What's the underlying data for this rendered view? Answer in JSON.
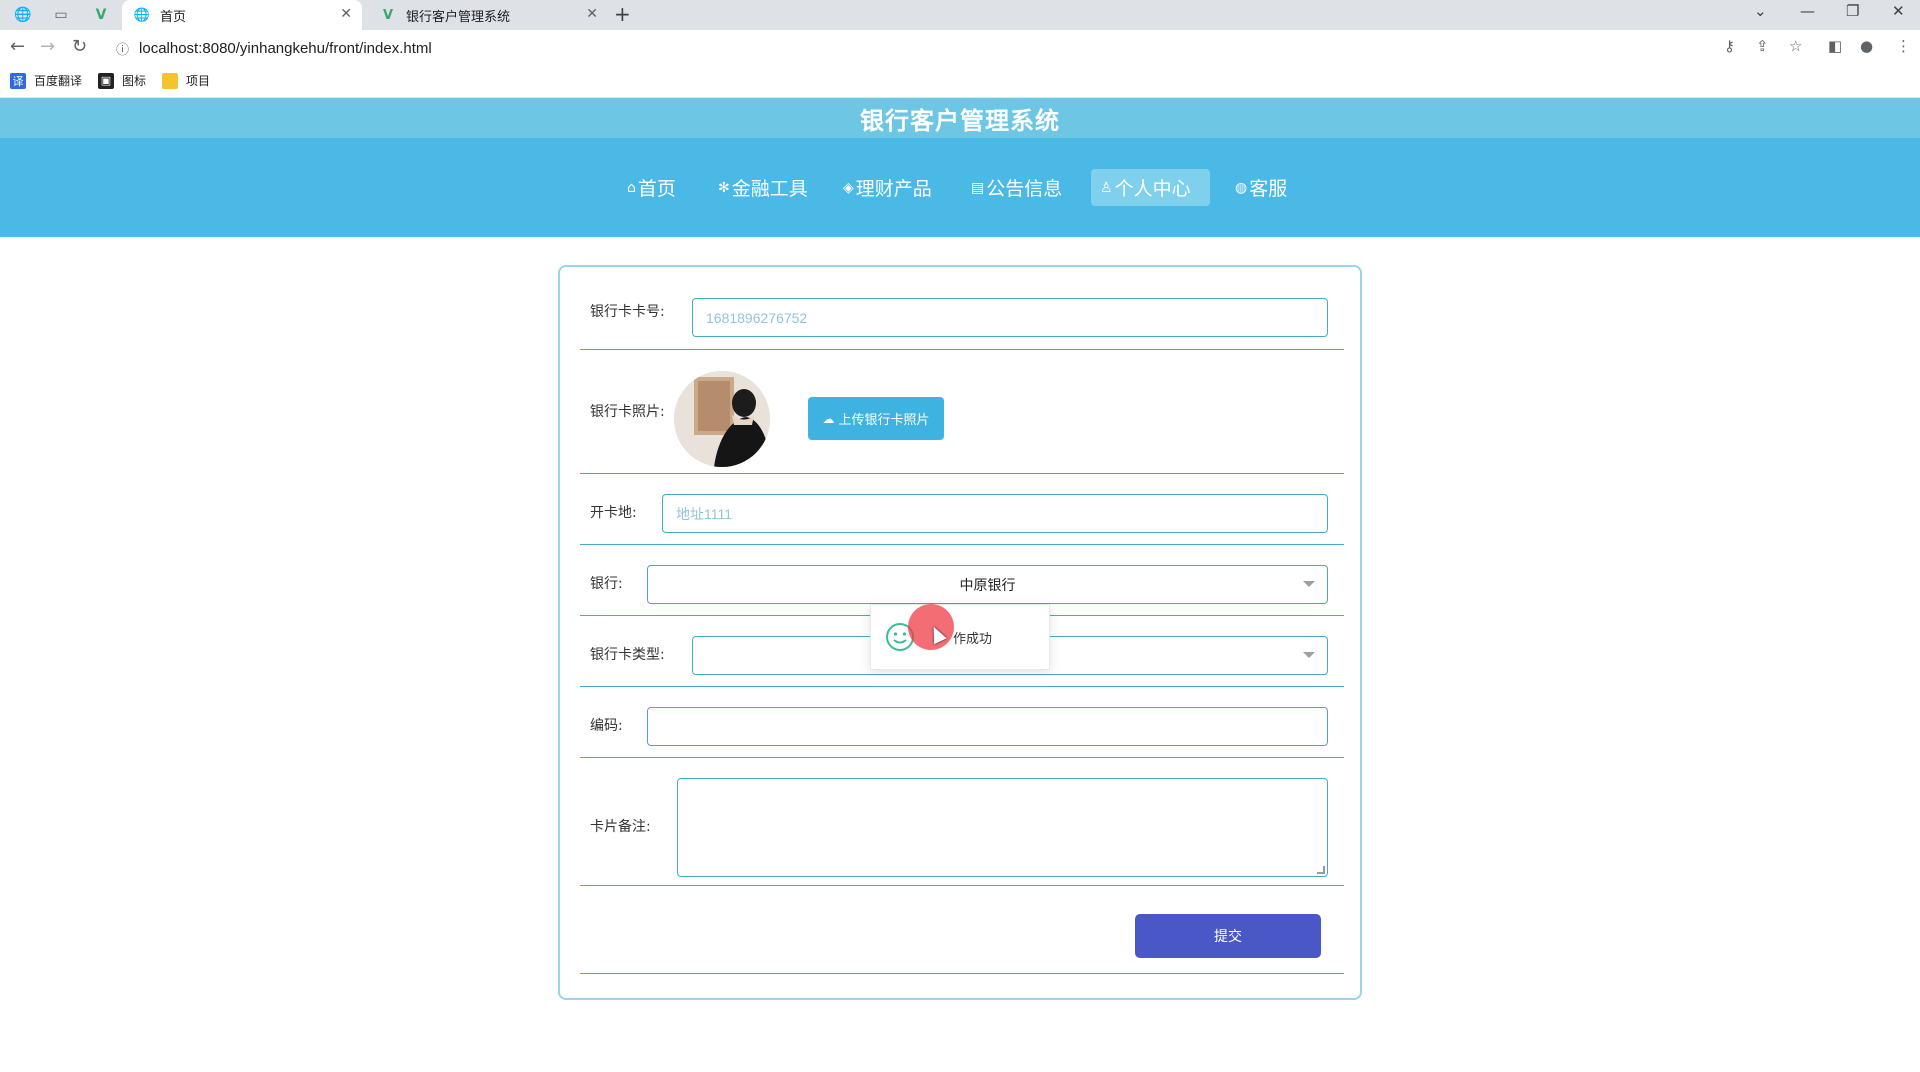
{
  "browser": {
    "tabs": [
      {
        "title": "首页",
        "active": true
      },
      {
        "title": "银行客户管理系统",
        "active": false
      }
    ],
    "url": "localhost:8080/yinhangkehu/front/index.html",
    "bookmarks": [
      {
        "label": "百度翻译",
        "icon": "translate-icon"
      },
      {
        "label": "图标",
        "icon": "image-icon"
      },
      {
        "label": "项目",
        "icon": "folder-icon"
      }
    ]
  },
  "site": {
    "title": "银行客户管理系统",
    "nav": [
      {
        "label": "首页",
        "icon": "home-icon",
        "active": false
      },
      {
        "label": "金融工具",
        "icon": "gear-icon",
        "active": false
      },
      {
        "label": "理财产品",
        "icon": "layers-icon",
        "active": false
      },
      {
        "label": "公告信息",
        "icon": "document-icon",
        "active": false
      },
      {
        "label": "个人中心",
        "icon": "user-icon",
        "active": true
      },
      {
        "label": "客服",
        "icon": "chat-icon",
        "active": false
      }
    ]
  },
  "form": {
    "card_number_label": "银行卡卡号:",
    "card_number_value": "1681896276752",
    "card_photo_label": "银行卡照片:",
    "upload_button": "上传银行卡照片",
    "open_place_label": "开卡地:",
    "open_place_value": "地址1111",
    "bank_label": "银行:",
    "bank_value": "中原银行",
    "card_type_label": "银行卡类型:",
    "card_type_value": "",
    "code_label": "编码:",
    "code_value": "",
    "remark_label": "卡片备注:",
    "remark_value": "",
    "submit_button": "提交"
  },
  "toast": {
    "message": "操作成功",
    "visible_text": "作成功"
  },
  "colors": {
    "header": "#6ec6e5",
    "nav_band": "#4bb9e5",
    "submit": "#4957c7",
    "upload": "#3eb2e0",
    "border": "#4aa8c7"
  }
}
